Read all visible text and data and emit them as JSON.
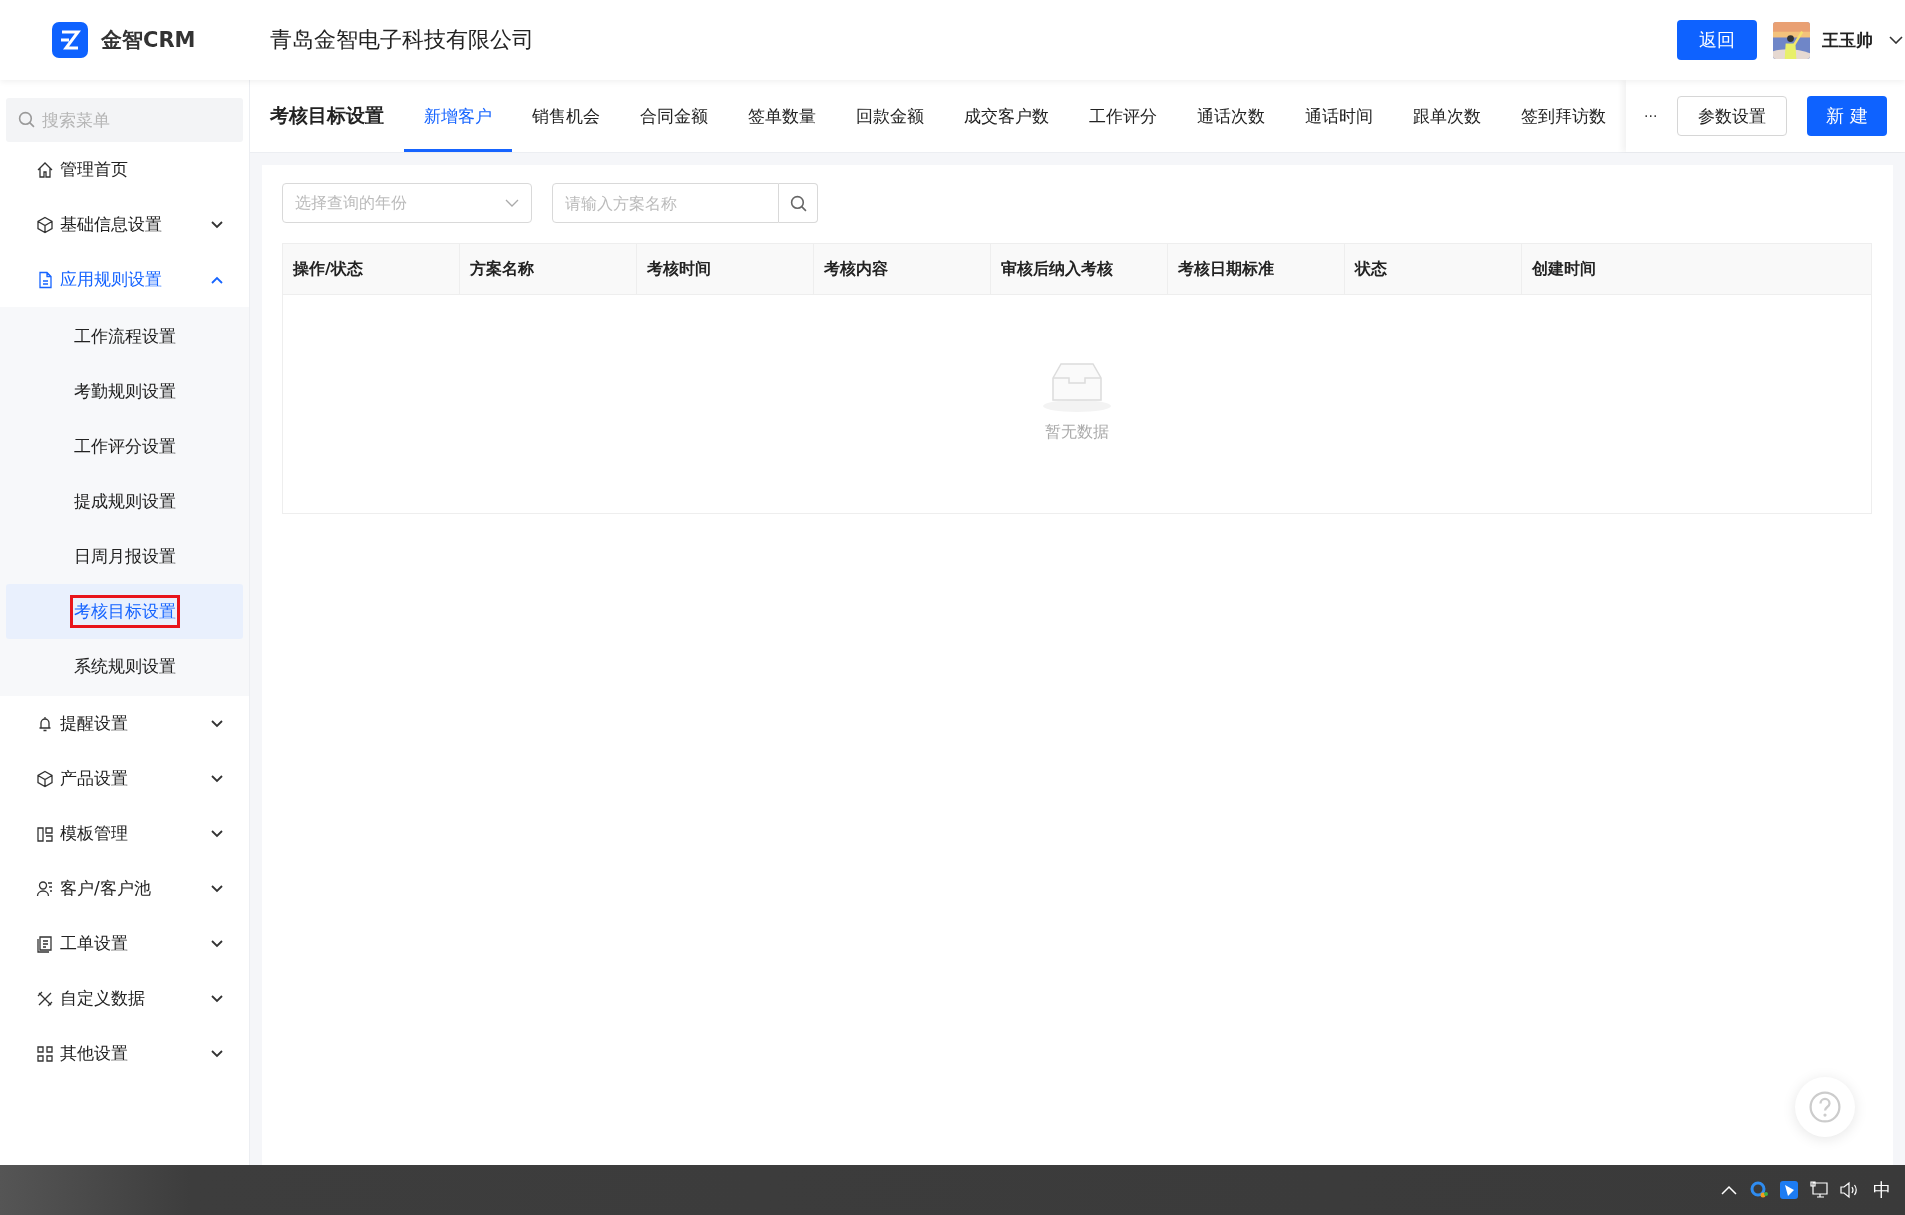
{
  "header": {
    "brand": "金智CRM",
    "company": "青岛金智电子科技有限公司",
    "back_button": "返回",
    "user_name": "王玉帅"
  },
  "sidebar": {
    "search": {
      "placeholder": "搜索菜单"
    },
    "items": [
      {
        "label": "管理首页"
      },
      {
        "label": "基础信息设置",
        "expanded": false
      },
      {
        "label": "应用规则设置",
        "expanded": true,
        "children": [
          {
            "label": "工作流程设置",
            "selected": false,
            "highlighted": false
          },
          {
            "label": "考勤规则设置",
            "selected": false,
            "highlighted": false
          },
          {
            "label": "工作评分设置",
            "selected": false,
            "highlighted": false
          },
          {
            "label": "提成规则设置",
            "selected": false,
            "highlighted": false
          },
          {
            "label": "日周月报设置",
            "selected": false,
            "highlighted": false
          },
          {
            "label": "考核目标设置",
            "selected": true,
            "highlighted": true
          },
          {
            "label": "系统规则设置",
            "selected": false,
            "highlighted": false
          }
        ]
      },
      {
        "label": "提醒设置",
        "expanded": false
      },
      {
        "label": "产品设置",
        "expanded": false
      },
      {
        "label": "模板管理",
        "expanded": false
      },
      {
        "label": "客户/客户池",
        "expanded": false
      },
      {
        "label": "工单设置",
        "expanded": false
      },
      {
        "label": "自定义数据",
        "expanded": false
      },
      {
        "label": "其他设置",
        "expanded": false
      }
    ]
  },
  "toolbar": {
    "title": "考核目标设置",
    "tabs": [
      {
        "label": "新增客户",
        "selected": true
      },
      {
        "label": "销售机会",
        "selected": false
      },
      {
        "label": "合同金额",
        "selected": false
      },
      {
        "label": "签单数量",
        "selected": false
      },
      {
        "label": "回款金额",
        "selected": false
      },
      {
        "label": "成交客户数",
        "selected": false
      },
      {
        "label": "工作评分",
        "selected": false
      },
      {
        "label": "通话次数",
        "selected": false
      },
      {
        "label": "通话时间",
        "selected": false
      },
      {
        "label": "跟单次数",
        "selected": false
      },
      {
        "label": "签到拜访数",
        "selected": false
      }
    ],
    "more": "···",
    "settings_button": "参数设置",
    "new_button": "新 建"
  },
  "filters": {
    "year_select": {
      "placeholder": "选择查询的年份"
    },
    "name_search": {
      "placeholder": "请输入方案名称"
    }
  },
  "table": {
    "columns": [
      "操作/状态",
      "方案名称",
      "考核时间",
      "考核内容",
      "审核后纳入考核",
      "考核日期标准",
      "状态",
      "创建时间"
    ],
    "empty_text": "暂无数据"
  },
  "taskbar": {
    "ime": "中"
  }
}
